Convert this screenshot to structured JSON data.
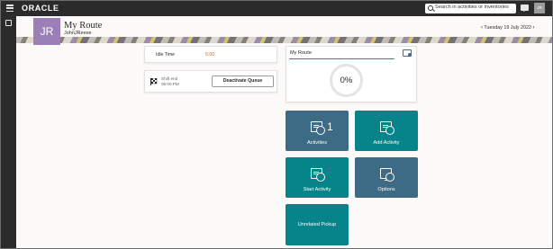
{
  "topbar": {
    "logo": "ORACLE",
    "search_placeholder": "Search in activities or inventories",
    "user_initials": "JR"
  },
  "header": {
    "avatar_initials": "JR",
    "title": "My Route",
    "user_name": "JohnJReese",
    "date": "Tuesday 19 July 2022",
    "prev_arrow": "‹",
    "next_arrow": "›"
  },
  "idle": {
    "label": "Idle Time",
    "value": "5:00"
  },
  "shift": {
    "label_line1": "Shift end",
    "label_line2": "05:00 PM",
    "button": "Deactivate Queue"
  },
  "route_card": {
    "title": "My Route",
    "progress": "0%"
  },
  "tiles": {
    "activities": {
      "label": "Activities",
      "count": "1"
    },
    "add_activity": {
      "label": "Add Activity"
    },
    "start_activity": {
      "label": "Start Activity"
    },
    "options": {
      "label": "Options"
    },
    "unrelated_pickup": {
      "label": "Unrelated Pickup"
    }
  },
  "colors": {
    "topbar": "#2b2b2b",
    "tile_slate": "#3d6a84",
    "tile_teal": "#07848a",
    "avatar": "#9b80b8",
    "idle_value": "#d0682b"
  }
}
